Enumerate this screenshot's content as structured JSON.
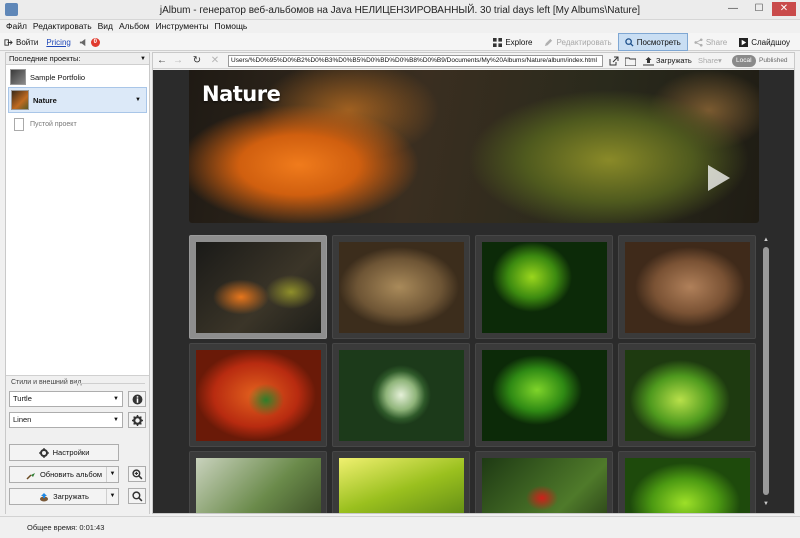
{
  "window": {
    "title": "jAlbum - генератор веб-альбомов на Java НЕЛИЦЕНЗИРОВАННЫЙ. 30 trial days left [My Albums\\Nature]",
    "minimize": "—",
    "maximize": "☐",
    "close": "✕"
  },
  "menu": [
    "Файл",
    "Редактировать",
    "Вид",
    "Альбом",
    "Инструменты",
    "Помощь"
  ],
  "toolbar": {
    "login": "Войти",
    "pricing": "Pricing",
    "notifications_count": "0",
    "explore": "Explore",
    "edit": "Редактировать",
    "view": "Посмотреть",
    "share": "Share",
    "slideshow": "Слайдшоу"
  },
  "left_panel": {
    "recent_label": "Последние проекты:",
    "projects": [
      {
        "name": "Sample Portfolio"
      },
      {
        "name": "Nature"
      },
      {
        "name": "Пустой проект"
      }
    ],
    "styles_label": "Стили и внешний вид",
    "skin": "Turtle",
    "style": "Linen",
    "settings_button": "Настройки",
    "update_button": "Обновить альбом",
    "upload_button": "Загружать"
  },
  "browser": {
    "url": "Users/%D0%95%D0%B2%D0%B3%D0%B5%D0%BD%D0%B8%D0%B9/Documents/My%20Albums/Nature/album/index.html",
    "upload": "Загружать",
    "share": "Share",
    "local": "Local",
    "published": "Published"
  },
  "album": {
    "title": "Nature"
  },
  "status": {
    "text": "Общее время: 0:01:43"
  },
  "colors": {
    "accent": "#c9def3",
    "album_bg": "#2b2b2b",
    "selected_tile": "#8e8e8e"
  }
}
